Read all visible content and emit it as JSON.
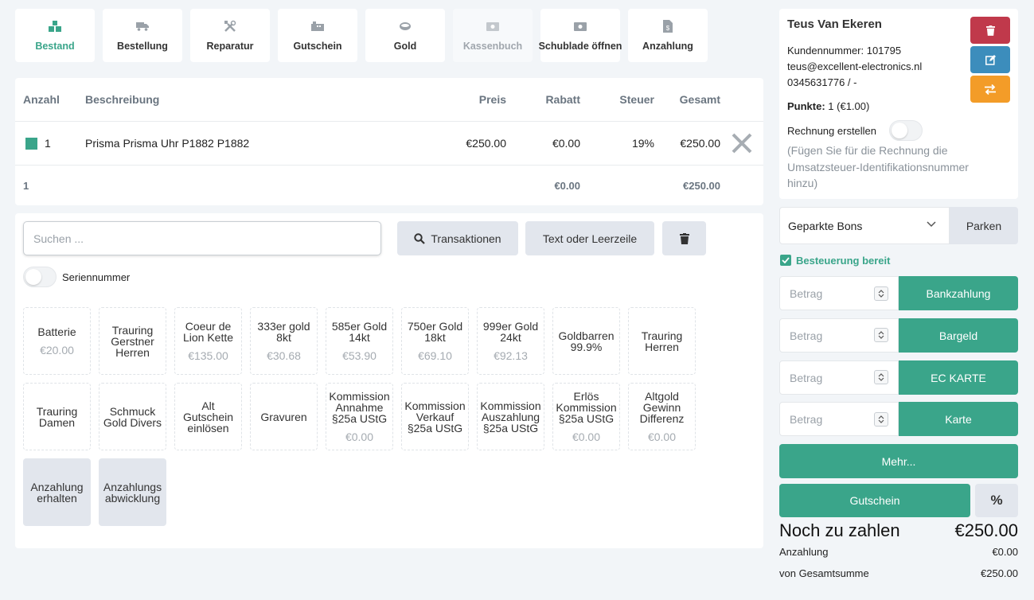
{
  "toolbar": [
    {
      "label": "Bestand",
      "icon": "boxes-icon",
      "active": true,
      "disabled": false
    },
    {
      "label": "Bestellung",
      "icon": "truck-icon",
      "active": false,
      "disabled": false
    },
    {
      "label": "Reparatur",
      "icon": "tools-icon",
      "active": false,
      "disabled": false
    },
    {
      "label": "Gutschein",
      "icon": "ticket-icon",
      "active": false,
      "disabled": false
    },
    {
      "label": "Gold",
      "icon": "gold-bar-icon",
      "active": false,
      "disabled": false
    },
    {
      "label": "Kassenbuch",
      "icon": "money-bill-icon",
      "active": false,
      "disabled": true
    },
    {
      "label": "Schublade öffnen",
      "icon": "money-bill-icon",
      "active": false,
      "disabled": false
    },
    {
      "label": "Anzahlung",
      "icon": "invoice-dollar-icon",
      "active": false,
      "disabled": false
    }
  ],
  "cart": {
    "headers": {
      "qty": "Anzahl",
      "desc": "Beschreibung",
      "price": "Preis",
      "discount": "Rabatt",
      "tax": "Steuer",
      "total": "Gesamt"
    },
    "items": [
      {
        "qty": "1",
        "desc": "Prisma Prisma Uhr P1882 P1882",
        "price": "€250.00",
        "discount": "€0.00",
        "tax": "19%",
        "total": "€250.00"
      }
    ],
    "summary": {
      "qty": "1",
      "discount": "€0.00",
      "total": "€250.00"
    }
  },
  "search": {
    "placeholder": "Suchen ..."
  },
  "buttons": {
    "transactions": "Transaktionen",
    "text_line": "Text oder Leerzeile"
  },
  "serial_label": "Seriennummer",
  "tiles": [
    {
      "name": "Batterie",
      "price": "€20.00"
    },
    {
      "name": "Trauring Gerstner Herren",
      "price": ""
    },
    {
      "name": "Coeur de Lion Kette",
      "price": "€135.00"
    },
    {
      "name": "333er gold 8kt",
      "price": "€30.68"
    },
    {
      "name": "585er Gold 14kt",
      "price": "€53.90"
    },
    {
      "name": "750er Gold 18kt",
      "price": "€69.10"
    },
    {
      "name": "999er Gold 24kt",
      "price": "€92.13"
    },
    {
      "name": "Goldbarren 99.9%",
      "price": ""
    },
    {
      "name": "Trauring Herren",
      "price": ""
    },
    {
      "name": "Trauring Damen",
      "price": ""
    },
    {
      "name": "Schmuck Gold Divers",
      "price": ""
    },
    {
      "name": "Alt Gutschein einlösen",
      "price": ""
    },
    {
      "name": "Gravuren",
      "price": ""
    },
    {
      "name": "Kommission Annahme §25a UStG",
      "price": "€0.00"
    },
    {
      "name": "Kommission Verkauf §25a UStG",
      "price": ""
    },
    {
      "name": "Kommission Auszahlung §25a UStG",
      "price": ""
    },
    {
      "name": "Erlös Kommission §25a UStG",
      "price": "€0.00"
    },
    {
      "name": "Altgold Gewinn Differenz",
      "price": "€0.00"
    },
    {
      "name": "Anzahlung erhalten",
      "price": "",
      "filled": true
    },
    {
      "name": "Anzahlungs abwicklung",
      "price": "",
      "filled": true
    }
  ],
  "customer": {
    "name": "Teus Van Ekeren",
    "number": "Kundennummer: 101795",
    "email": "teus@excellent-electronics.nl",
    "phone": "0345631776 / -",
    "points_label": "Punkte:",
    "points_value": "1 (€1.00)",
    "invoice_label": "Rechnung erstellen",
    "invoice_note": "(Fügen Sie für die Rechnung die Umsatzsteuer-Identifikationsnummer hinzu)"
  },
  "parked": {
    "label": "Geparkte Bons",
    "button": "Parken"
  },
  "tax_ready": "Besteuerung bereit",
  "payments": [
    {
      "placeholder": "Betrag",
      "label": "Bankzahlung"
    },
    {
      "placeholder": "Betrag",
      "label": "Bargeld"
    },
    {
      "placeholder": "Betrag",
      "label": "EC KARTE"
    },
    {
      "placeholder": "Betrag",
      "label": "Karte"
    }
  ],
  "more": "Mehr...",
  "voucher": "Gutschein",
  "percent": "%",
  "totals": {
    "due_label": "Noch zu zahlen",
    "due_value": "€250.00",
    "deposit_label": "Anzahlung",
    "deposit_value": "€0.00",
    "grand_label": "von Gesamtsumme",
    "grand_value": "€250.00"
  },
  "colors": {
    "accent": "#3aa58a",
    "danger": "#c0394b",
    "info": "#3c8dbc",
    "warning": "#f39c28"
  }
}
